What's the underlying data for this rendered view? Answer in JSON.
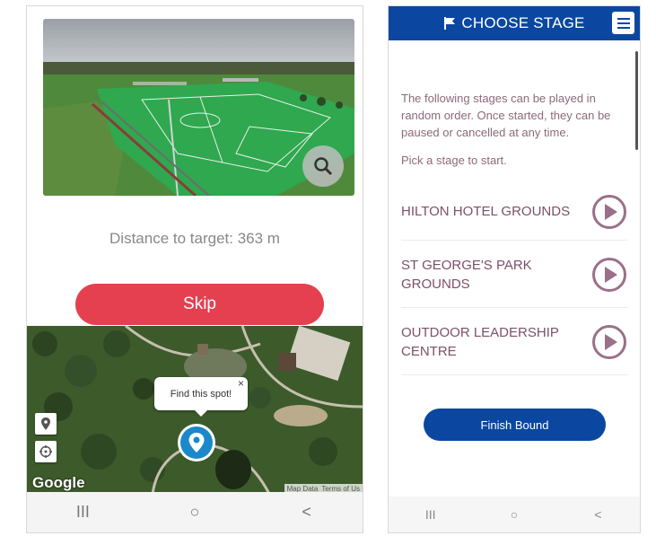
{
  "left": {
    "distance_text": "Distance to target: 363 m",
    "skip_label": "Skip",
    "callout_text": "Find this spot!",
    "callout_close": "×",
    "google_logo": "Google",
    "attribution": {
      "map_data": "Map Data",
      "terms": "Terms of Us"
    },
    "nav": {
      "recent": "III",
      "home": "○",
      "back": "<"
    },
    "colors": {
      "skip": "#e5404f",
      "pin": "#1a88c9"
    }
  },
  "right": {
    "title": "CHOOSE STAGE",
    "intro": "The following stages can be played in random order. Once started, they can be paused or cancelled at any time.",
    "pick": "Pick a stage to start.",
    "stages": [
      {
        "label": "HILTON HOTEL GROUNDS"
      },
      {
        "label": "ST GEORGE'S PARK GROUNDS"
      },
      {
        "label": "OUTDOOR LEADERSHIP CENTRE"
      }
    ],
    "finish_label": "Finish Bound",
    "nav": {
      "recent": "III",
      "home": "○",
      "back": "<"
    },
    "colors": {
      "header": "#0b47a0",
      "stage_text": "#7c5068",
      "play": "#9a7089"
    }
  },
  "icons": [
    "flag-icon",
    "menu-icon",
    "play-icon",
    "search-icon",
    "map-pin-icon",
    "compass-icon",
    "location-pin-icon"
  ]
}
